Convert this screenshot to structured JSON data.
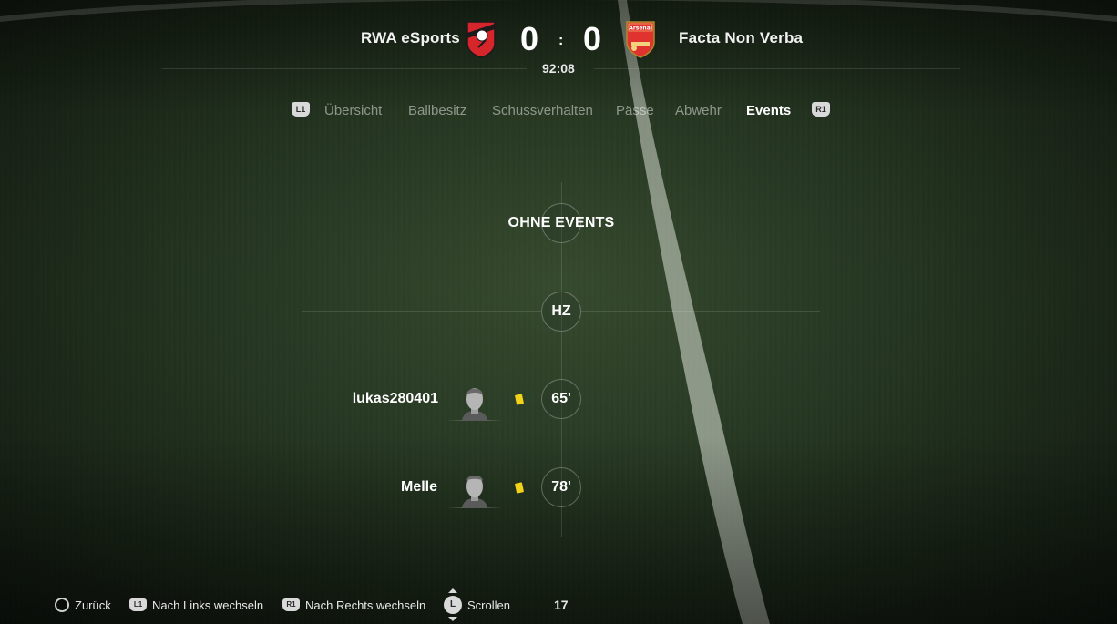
{
  "header": {
    "home_team": "RWA eSports",
    "away_team": "Facta Non Verba",
    "home_score": "0",
    "away_score": "0",
    "score_separator": ":",
    "match_time": "92:08",
    "away_crest_text": "Arsenal"
  },
  "tabs": {
    "left_shoulder": "L1",
    "right_shoulder": "R1",
    "items": [
      {
        "label": "Übersicht",
        "active": false
      },
      {
        "label": "Ballbesitz",
        "active": false
      },
      {
        "label": "Schussverhalten",
        "active": false
      },
      {
        "label": "Pässe",
        "active": false
      },
      {
        "label": "Abwehr",
        "active": false
      },
      {
        "label": "Events",
        "active": true
      }
    ]
  },
  "timeline": {
    "first_half_label": "OHNE EVENTS",
    "halftime_label": "HZ",
    "events": [
      {
        "player": "lukas280401",
        "minute": "65'",
        "type": "yellow-card"
      },
      {
        "player": "Melle",
        "minute": "78'",
        "type": "yellow-card"
      }
    ]
  },
  "footer": {
    "back_label": "Zurück",
    "prev_button": "L1",
    "prev_label": "Nach Links wechseln",
    "next_button": "R1",
    "next_label": "Nach Rechts wechseln",
    "scroll_button": "L",
    "scroll_label": "Scrollen",
    "page_number": "17"
  },
  "colors": {
    "pitch": "#263823",
    "yellow_card": "#f3d21a",
    "home_crest": "#d6262c",
    "away_crest": "#e03330"
  }
}
